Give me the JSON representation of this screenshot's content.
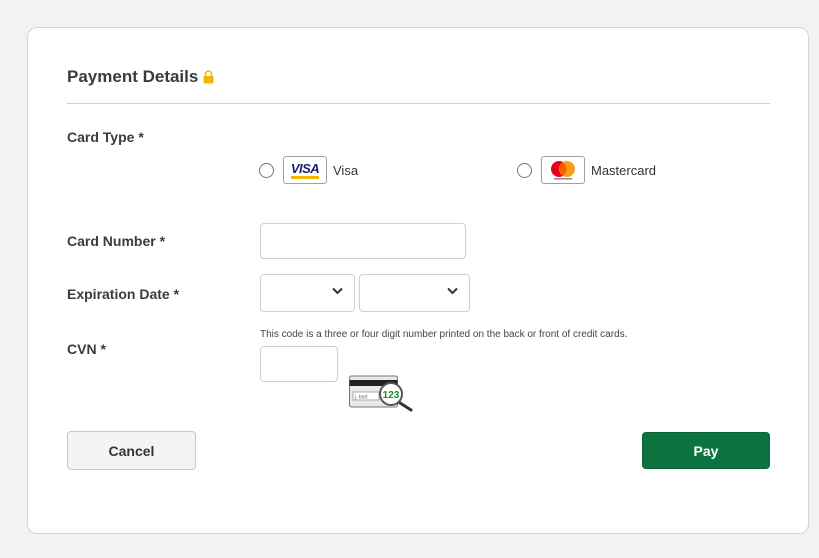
{
  "form": {
    "title": "Payment Details",
    "card_type_label": "Card Type *",
    "card_options": [
      {
        "label": "Visa",
        "logo_text": "VISA",
        "icon": "visa-logo-icon"
      },
      {
        "label": "Mastercard",
        "icon": "mastercard-logo-icon"
      }
    ],
    "card_number_label": "Card Number *",
    "card_number_value": "",
    "expiration_label": "Expiration Date *",
    "expiration_month_value": "",
    "expiration_year_value": "",
    "cvn_label": "CVN *",
    "cvn_hint": "This code is a three or four digit number printed on the back or front of credit cards.",
    "cvn_value": "",
    "cvv_illustration_digits": "123"
  },
  "actions": {
    "cancel_label": "Cancel",
    "pay_label": "Pay"
  },
  "colors": {
    "pay_button": "#0d7341",
    "lock_icon": "#f2b705",
    "visa_blue": "#1a1f71",
    "mastercard_red": "#eb001b",
    "mastercard_orange": "#f79e1b"
  }
}
